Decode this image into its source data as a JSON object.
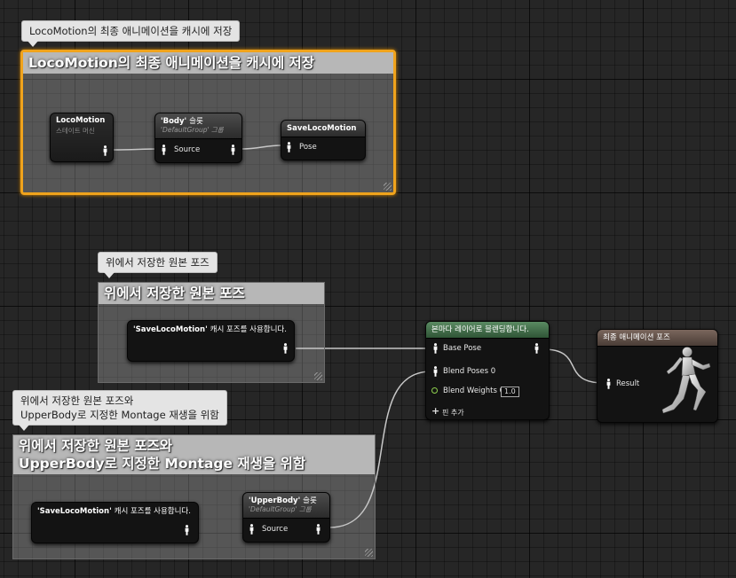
{
  "comments": {
    "top": {
      "bubble": "LocoMotion의 최종 애니메이션을 캐시에 저장",
      "title": "LocoMotion의 최종 애니메이션을 캐시에 저장"
    },
    "middle": {
      "bubble": "위에서 저장한 원본 포즈",
      "title": "위에서 저장한 원본 포즈"
    },
    "bottom": {
      "bubble": "위에서 저장한 원본 포즈와\nUpperBody로 지정한 Montage 재생을 위함",
      "title": "위에서 저장한 원본 포즈와\nUpperBody로 지정한 Montage 재생을 위함"
    }
  },
  "nodes": {
    "locomotion": {
      "title": "LocoMotion",
      "subtitle": "스테이트 머신"
    },
    "body_slot": {
      "title_q": "'Body'",
      "title_suffix": "슬롯",
      "subtitle": "'DefaultGroup' 그룹",
      "pin": "Source"
    },
    "save_loco": {
      "title": "SaveLocoMotion",
      "pin": "Pose"
    },
    "use_cache_1": {
      "title_q": "'SaveLocoMotion'",
      "title_suffix": "캐시 포즈를 사용합니다."
    },
    "use_cache_2": {
      "title_q": "'SaveLocoMotion'",
      "title_suffix": "캐시 포즈를 사용합니다."
    },
    "upper_slot": {
      "title_q": "'UpperBody'",
      "title_suffix": "슬롯",
      "subtitle": "'DefaultGroup' 그룹",
      "pin": "Source"
    },
    "blend": {
      "title": "본마다 레이어로 블렌딩합니다.",
      "base_pose": "Base Pose",
      "blend_poses": "Blend Poses 0",
      "blend_weights": "Blend Weights 0",
      "blend_weight_value": "1.0",
      "add_pin": "핀 추가"
    },
    "output": {
      "title": "최종 애니메이션 포즈",
      "result": "Result"
    }
  },
  "colors": {
    "selection": "#f0a31c",
    "wire": "#c8c8c8",
    "blend_header": "#4f7f57",
    "output_header": "#6e5b51",
    "float_pin": "#8fd14f"
  },
  "icons": {
    "pose_pin": "person-icon",
    "add_pin": "plus-icon",
    "output_preview": "mannequin-icon"
  }
}
